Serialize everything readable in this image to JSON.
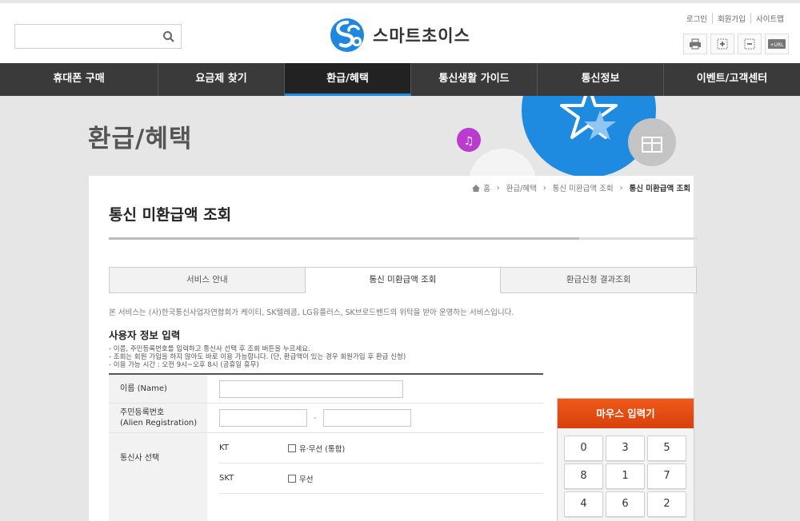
{
  "header": {
    "search_placeholder": "",
    "logo_text": "스마트초이스",
    "util_links": [
      "로그인",
      "회원가입",
      "사이트맵"
    ],
    "util_icons": [
      "print-icon",
      "zoom-in-icon",
      "zoom-out-icon",
      "url-icon"
    ],
    "util_icon_url_label": "+URL"
  },
  "nav": {
    "items": [
      "휴대폰 구매",
      "요금제 찾기",
      "환급/혜택",
      "통신생활 가이드",
      "통신정보",
      "이벤트/고객센터"
    ],
    "active_index": 2
  },
  "banner": {
    "title": "환급/혜택"
  },
  "breadcrumb": {
    "home": "홈",
    "items": [
      "환급/혜택",
      "통신 미환급액 조회"
    ],
    "current": "통신 미환급액 조회"
  },
  "page": {
    "title": "통신 미환급액 조회",
    "tabs": [
      "서비스 안내",
      "통신 미환급액 조회",
      "환급신청 결과조회"
    ],
    "active_tab": 1,
    "notice": "본 서비스는 (사)한국통신사업자연합회가 케이티, SK텔레콤, LG유플러스, SK브로드밴드의 위탁을 받아 운영하는 서비스입니다.",
    "section_title": "사용자 정보 입력",
    "instructions": [
      "- 이름, 주민등록번호를 입력하고 통신사 선택 후 조회 버튼을 누르세요.",
      "- 조회는 회원 가입을 하지 않아도 바로 이용 가능합니다. (단, 환급액이 있는 경우 회원가입 후 환급 신청)",
      "- 이용 가능 시간 : 오전 9시~오후 8시 (공휴일 휴무)"
    ]
  },
  "form": {
    "name_label": "이름 (Name)",
    "name_value": "",
    "reg_label_1": "주민등록번호",
    "reg_label_2": "(Alien Registration)",
    "reg_front_value": "",
    "reg_back_value": "",
    "reg_separator": "-",
    "carrier_label": "통신사 선택",
    "carriers": [
      {
        "name": "KT",
        "option": "유·무선 (통합)"
      },
      {
        "name": "SKT",
        "option": "무선"
      }
    ]
  },
  "keypad": {
    "title": "마우스 입력기",
    "keys": [
      "0",
      "3",
      "5",
      "8",
      "1",
      "7",
      "4",
      "6",
      "2"
    ]
  },
  "colors": {
    "nav_bg": "#3a3a3a",
    "nav_active_underline": "#1f8be0",
    "keypad_header": "#e44c0f",
    "banner_circle": "#1f8be0"
  }
}
